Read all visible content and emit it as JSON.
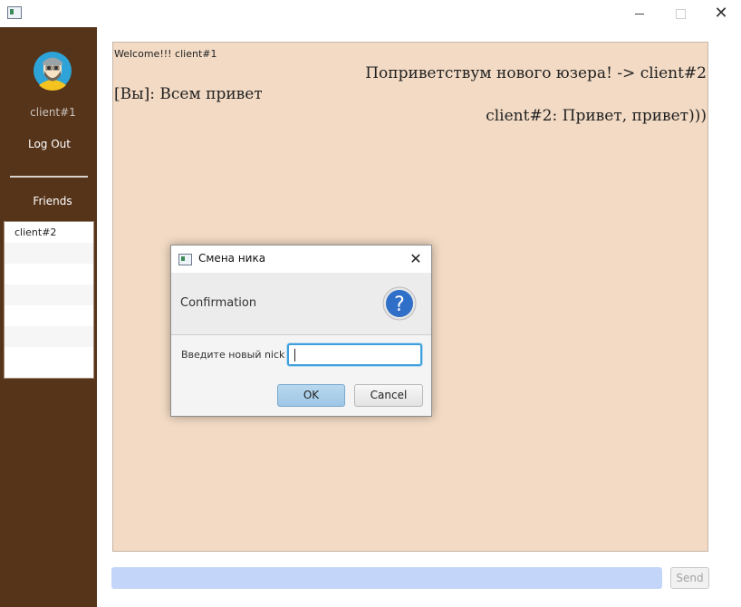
{
  "window": {
    "minimize_symbol": "",
    "maximize_symbol": "",
    "close_symbol": "✕"
  },
  "sidebar": {
    "username": "client#1",
    "logout_label": "Log Out",
    "friends_title": "Friends",
    "friends": [
      "client#2",
      "",
      "",
      "",
      "",
      "",
      ""
    ]
  },
  "chat": {
    "welcome": "Welcome!!! client#1",
    "messages": [
      {
        "text": "Поприветствум нового юзера! -> client#2",
        "align": "right"
      },
      {
        "text": "[Вы]: Всем привет",
        "align": "left"
      },
      {
        "text": "client#2: Привет, привет)))",
        "align": "right"
      }
    ]
  },
  "input": {
    "value": "",
    "send_label": "Send"
  },
  "dialog": {
    "title": "Смена ника",
    "heading": "Confirmation",
    "question_symbol": "?",
    "field_label": "Введите новый nick",
    "field_value": "",
    "ok_label": "OK",
    "cancel_label": "Cancel",
    "close_symbol": "✕"
  },
  "colors": {
    "sidebar": "#56341a",
    "chat_background": "#f2dac4",
    "input_background": "#c3d6f9",
    "accent_blue": "#3f9fdc"
  }
}
